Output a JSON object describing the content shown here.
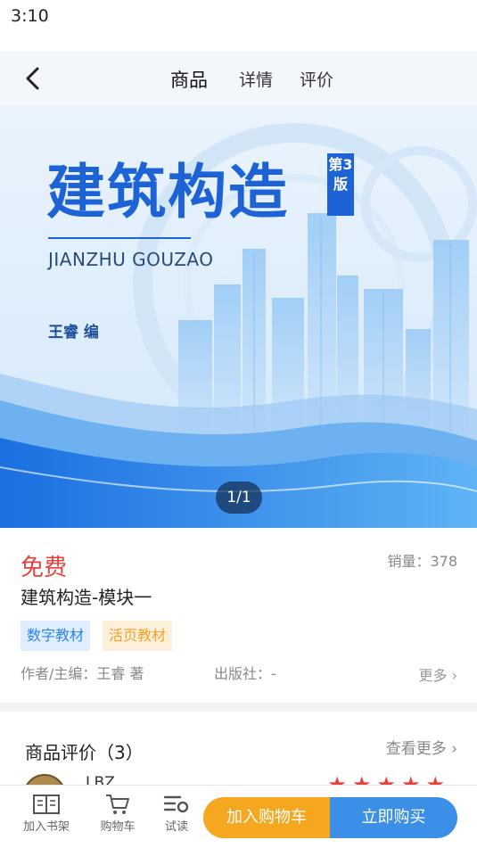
{
  "status_bar": {
    "time": "3:10"
  },
  "nav": {
    "tabs": [
      {
        "label": "商品",
        "active": true
      },
      {
        "label": "详情",
        "active": false
      },
      {
        "label": "评价",
        "active": false
      }
    ]
  },
  "cover": {
    "title": "建筑构造",
    "edition": "第3版",
    "pinyin": "JIANZHU GOUZAO",
    "author": "王睿 编",
    "counter": "1/1"
  },
  "product": {
    "price": "免费",
    "sales": "销量：378",
    "name": "建筑构造-模块一",
    "tags": [
      "数字教材",
      "活页教材"
    ],
    "author": "作者/主编：王睿 著",
    "publisher": "出版社：-",
    "more": "更多 ›"
  },
  "reviews": {
    "title": "商品评价（3）",
    "see_more": "查看更多 ›",
    "first_user": "LBZ",
    "stars": "★★★★★"
  },
  "bottom_bar": {
    "bookshelf": "加入书架",
    "cart": "购物车",
    "trial": "试读",
    "add_to_cart": "加入购物车",
    "buy_now": "立即购买"
  },
  "colors": {
    "price": "#e8413a",
    "cart_button": "#f6a720",
    "buy_button": "#3b8fe6",
    "cover_blue": "#1d63d6"
  }
}
